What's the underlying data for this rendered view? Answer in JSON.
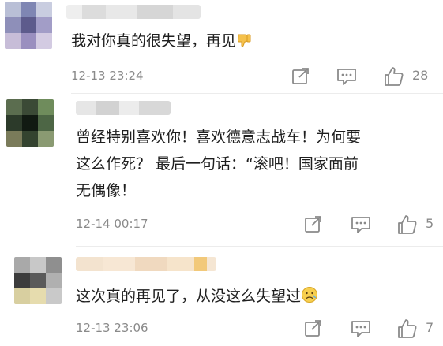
{
  "comments": [
    {
      "text": "我对你真的很失望，再见",
      "emoji": "thumbs-down-emoji",
      "time": "12-13 23:24",
      "likes": "28"
    },
    {
      "text_line1": "曾经特别喜欢你！喜欢德意志战车！为何要",
      "text_line2": "这么作死？ 最后一句话：“滚吧！国家面前",
      "text_line3": "无偶像！",
      "time": "12-14 00:17",
      "likes": "5"
    },
    {
      "text": "这次真的再见了，从没这么失望过",
      "emoji": "disappointed-face-emoji",
      "time": "12-13 23:06",
      "likes": "7"
    }
  ],
  "icons": [
    "share-icon",
    "comment-icon",
    "like-icon"
  ],
  "colors": {
    "text": "#1f1f1f",
    "meta": "#8a8a8a",
    "divider": "#ececec"
  }
}
